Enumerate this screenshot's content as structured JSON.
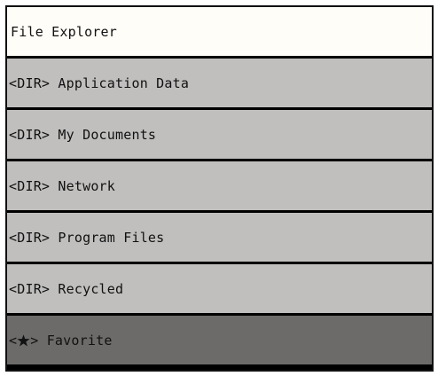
{
  "window": {
    "title": "File Explorer"
  },
  "entries": [
    {
      "prefix": "<DIR>",
      "name": "Application Data"
    },
    {
      "prefix": "<DIR>",
      "name": "My Documents"
    },
    {
      "prefix": "<DIR>",
      "name": "Network"
    },
    {
      "prefix": "<DIR>",
      "name": "Program Files"
    },
    {
      "prefix": "<DIR>",
      "name": "Recycled"
    }
  ],
  "favorite": {
    "prefix_open": "<",
    "icon": "star-icon",
    "prefix_close": ">",
    "name": "Favorite",
    "selected": true
  },
  "colors": {
    "title_bg": "#fffdf8",
    "item_bg": "#c0bfbe",
    "selected_bg": "#6c6b6a",
    "border": "#111111"
  }
}
